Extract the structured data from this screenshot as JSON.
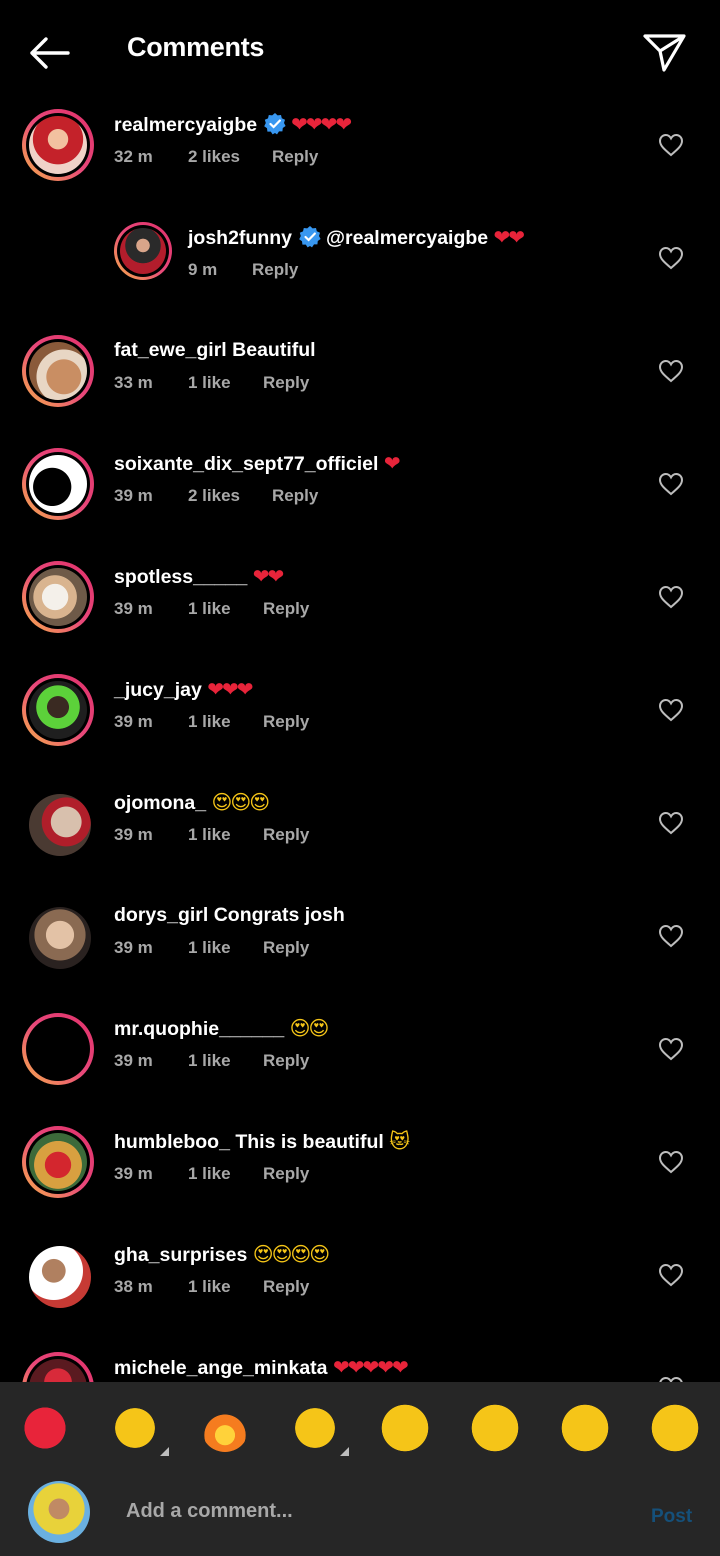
{
  "header": {
    "title": "Comments"
  },
  "comments": [
    {
      "user": "realmercyaigbe",
      "verified": true,
      "text": "",
      "emoji": "❤❤❤❤",
      "time": "32 m",
      "likes": "2 likes",
      "reply": "Reply"
    },
    {
      "user": "josh2funny",
      "verified": true,
      "text": "@realmercyaigbe",
      "emoji": "❤❤",
      "time": "9 m",
      "likes": "",
      "reply": "Reply"
    },
    {
      "user": "fat_ewe_girl",
      "verified": false,
      "text": "Beautiful",
      "emoji": "",
      "time": "33 m",
      "likes": "1 like",
      "reply": "Reply"
    },
    {
      "user": "soixante_dix_sept77_officiel",
      "verified": false,
      "text": "",
      "emoji": "❤",
      "time": "39 m",
      "likes": "2 likes",
      "reply": "Reply"
    },
    {
      "user": "spotless_____",
      "verified": false,
      "text": "",
      "emoji": "❤❤",
      "time": "39 m",
      "likes": "1 like",
      "reply": "Reply"
    },
    {
      "user": "_jucy_jay",
      "verified": false,
      "text": "",
      "emoji": "❤❤❤",
      "time": "39 m",
      "likes": "1 like",
      "reply": "Reply"
    },
    {
      "user": "ojomona_",
      "verified": false,
      "text": "",
      "emoji": "😍😍😍",
      "time": "39 m",
      "likes": "1 like",
      "reply": "Reply"
    },
    {
      "user": "dorys_girl",
      "verified": false,
      "text": "Congrats josh",
      "emoji": "",
      "time": "39 m",
      "likes": "1 like",
      "reply": "Reply"
    },
    {
      "user": "mr.quophie______",
      "verified": false,
      "text": "",
      "emoji": "😍😍",
      "time": "39 m",
      "likes": "1 like",
      "reply": "Reply"
    },
    {
      "user": "humbleboo_",
      "verified": false,
      "text": "This is beautiful",
      "emoji": "😻",
      "time": "39 m",
      "likes": "1 like",
      "reply": "Reply"
    },
    {
      "user": "gha_surprises",
      "verified": false,
      "text": "",
      "emoji": "😍😍😍😍",
      "time": "38 m",
      "likes": "1 like",
      "reply": "Reply"
    },
    {
      "user": "michele_ange_minkata",
      "verified": false,
      "text": "",
      "emoji": "❤❤❤❤❤",
      "time": "",
      "likes": "",
      "reply": ""
    }
  ],
  "quick_reactions": [
    "❤",
    "🙌",
    "🔥",
    "👏",
    "😢",
    "😍",
    "😮",
    "😂"
  ],
  "composer": {
    "placeholder": "Add a comment...",
    "post_label": "Post"
  },
  "colors": {
    "verified": "#3897f0",
    "heart": "#e8243a",
    "post": "#15507a"
  }
}
